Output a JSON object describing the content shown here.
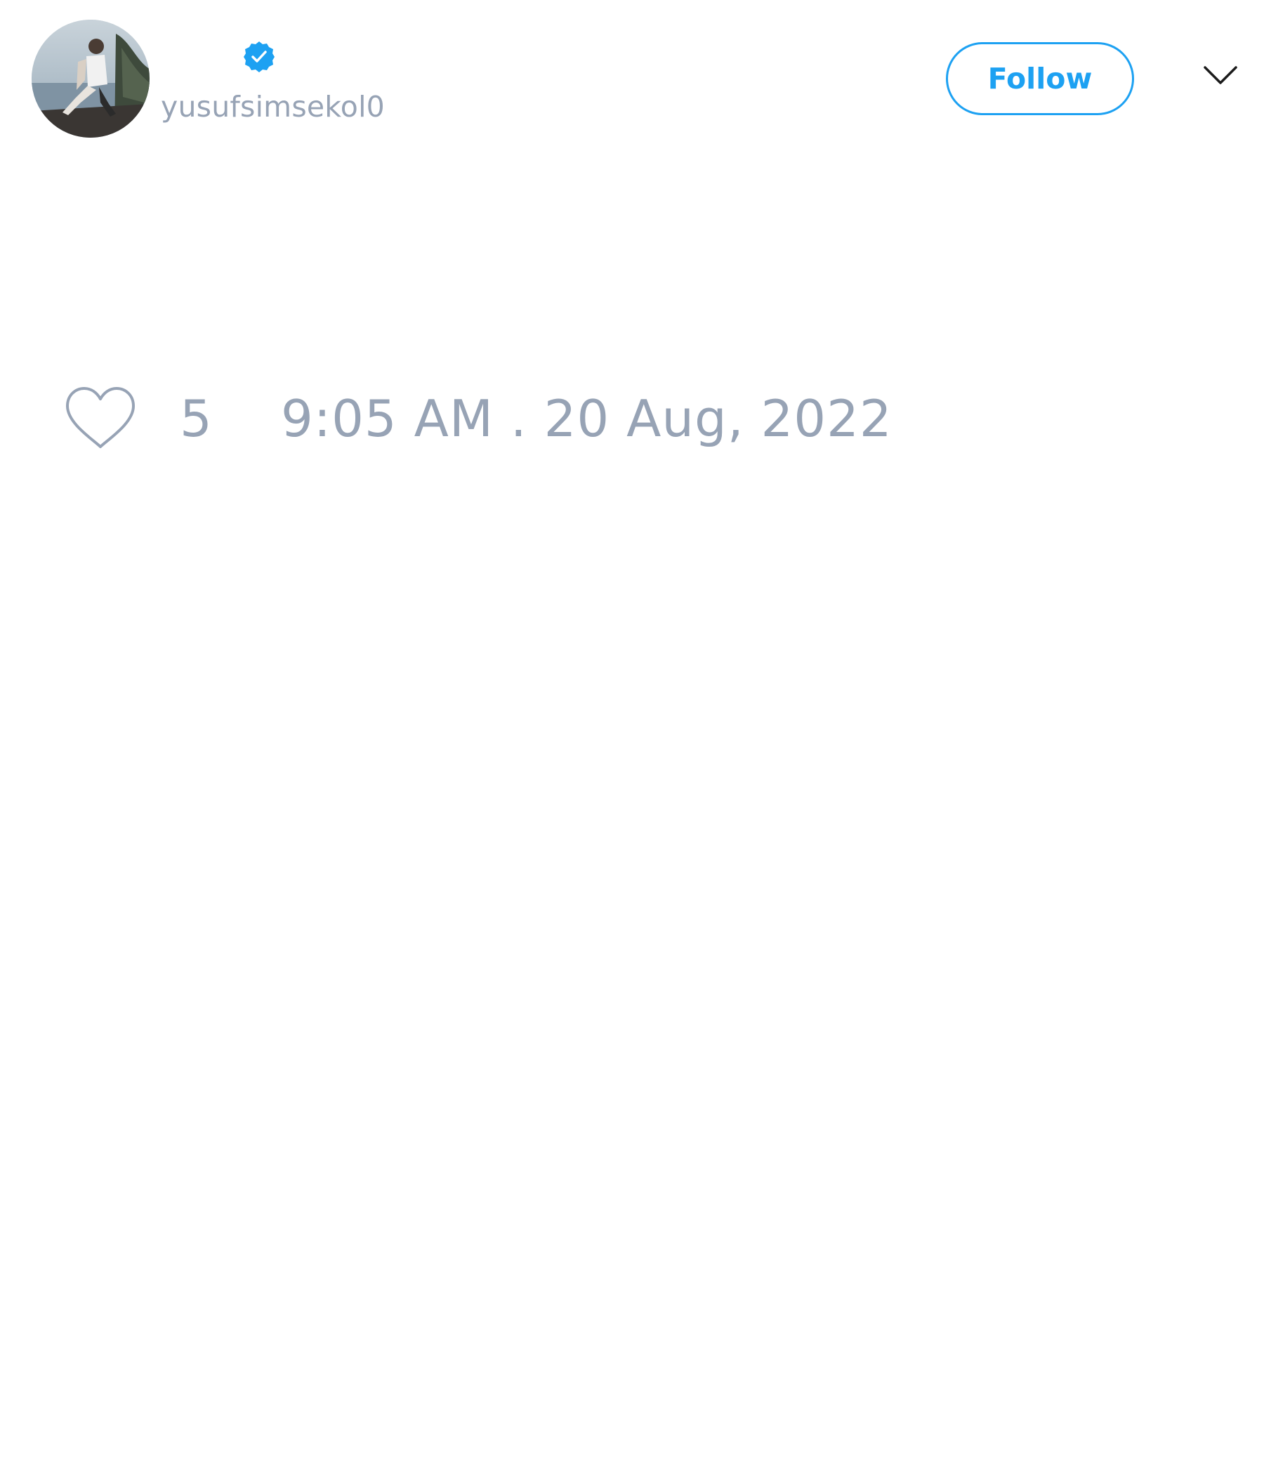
{
  "tweet": {
    "author": {
      "handle": "yusufsimsekol0",
      "verified": true,
      "avatar_icon": "profile-photo"
    },
    "follow_label": "Follow",
    "menu_icon": "chevron-down-icon",
    "likes": {
      "icon": "heart-icon",
      "count": "5"
    },
    "timestamp": "9:05 AM . 20 Aug, 2022"
  },
  "colors": {
    "accent": "#1da1f2",
    "muted_text": "#97a3b5",
    "background": "#ffffff"
  }
}
